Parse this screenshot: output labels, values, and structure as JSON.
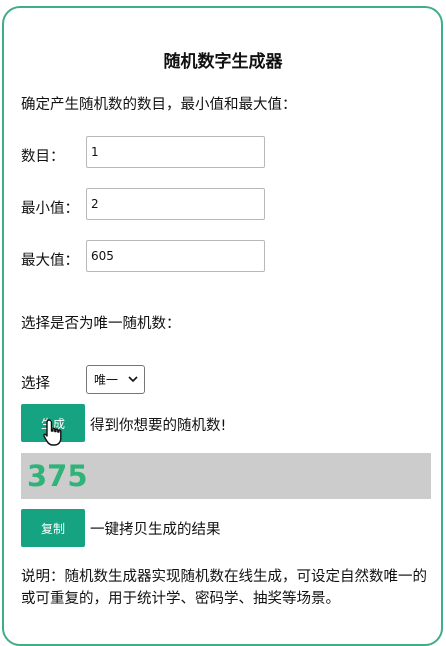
{
  "page": {
    "title": "随机数字生成器",
    "intro": "确定产生随机数的数目，最小值和最大值："
  },
  "form": {
    "count_label": "数目：",
    "count_value": "1",
    "min_label": "最小值：",
    "min_value": "2",
    "max_label": "最大值：",
    "max_value": "605",
    "unique_prompt": "选择是否为唯一随机数：",
    "select_label": "选择",
    "select_value": "唯一"
  },
  "actions": {
    "generate_label": "生成",
    "generate_hint": "得到你想要的随机数!",
    "copy_label": "复制",
    "copy_hint": "一键拷贝生成的结果"
  },
  "result": {
    "value": "375"
  },
  "footer": {
    "description": "说明：随机数生成器实现随机数在线生成，可设定自然数唯一的或可重复的，用于统计学、密码学、抽奖等场景。"
  },
  "colors": {
    "accent": "#16a381",
    "border": "#3fae86",
    "result_text": "#2fb378",
    "result_bg": "#cccccc"
  },
  "icons": {
    "select_arrow": "chevron-down-icon",
    "cursor": "hand-pointer-icon"
  }
}
